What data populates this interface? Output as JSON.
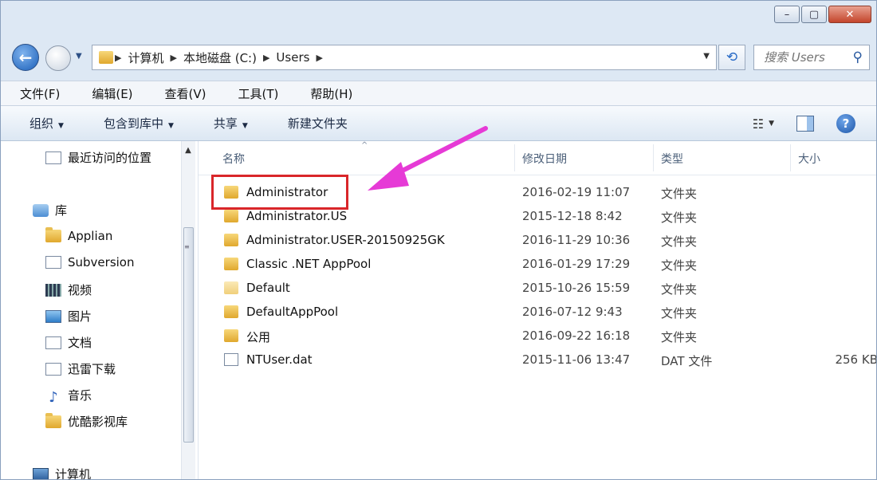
{
  "window": {
    "controls": {
      "minimize": "–",
      "maximize": "▢",
      "close": "✕"
    }
  },
  "navigation": {
    "back_glyph": "←",
    "history_drop": "▼",
    "breadcrumb": [
      "计算机",
      "本地磁盘 (C:)",
      "Users"
    ],
    "address_drop": "▼",
    "refresh_glyph": "⟲",
    "search_placeholder": "搜索 Users",
    "search_icon_glyph": "⚲"
  },
  "menubar": [
    "文件(F)",
    "编辑(E)",
    "查看(V)",
    "工具(T)",
    "帮助(H)"
  ],
  "toolbar": {
    "items": [
      "组织",
      "包含到库中",
      "共享",
      "新建文件夹"
    ],
    "dropdown_glyph": "▼",
    "view_glyph": "☷",
    "help_glyph": "?"
  },
  "sidebar": {
    "items": [
      {
        "label": "最近访问的位置",
        "icon": "recent-places-icon"
      },
      {
        "label": "库",
        "icon": "library-icon"
      },
      {
        "label": "Applian",
        "icon": "folder-icon"
      },
      {
        "label": "Subversion",
        "icon": "subversion-icon"
      },
      {
        "label": "视频",
        "icon": "video-icon"
      },
      {
        "label": "图片",
        "icon": "pictures-icon"
      },
      {
        "label": "文档",
        "icon": "documents-icon"
      },
      {
        "label": "迅雷下载",
        "icon": "download-icon"
      },
      {
        "label": "音乐",
        "icon": "music-icon"
      },
      {
        "label": "优酷影视库",
        "icon": "folder-icon"
      },
      {
        "label": "计算机",
        "icon": "computer-icon"
      }
    ],
    "scroll_up_glyph": "▲",
    "scroll_grip": "≡"
  },
  "columns": {
    "name": "名称",
    "date": "修改日期",
    "type": "类型",
    "size": "大小",
    "sort_glyph": "^"
  },
  "files": [
    {
      "name": "Administrator",
      "date": "2016-02-19 11:07",
      "type": "文件夹",
      "size": "",
      "kind": "folder"
    },
    {
      "name": "Administrator.US",
      "date": "2015-12-18 8:42",
      "type": "文件夹",
      "size": "",
      "kind": "folder"
    },
    {
      "name": "Administrator.USER-20150925GK",
      "date": "2016-11-29 10:36",
      "type": "文件夹",
      "size": "",
      "kind": "folder"
    },
    {
      "name": "Classic .NET AppPool",
      "date": "2016-01-29 17:29",
      "type": "文件夹",
      "size": "",
      "kind": "folder"
    },
    {
      "name": "Default",
      "date": "2015-10-26 15:59",
      "type": "文件夹",
      "size": "",
      "kind": "folder-light"
    },
    {
      "name": "DefaultAppPool",
      "date": "2016-07-12 9:43",
      "type": "文件夹",
      "size": "",
      "kind": "folder"
    },
    {
      "name": "公用",
      "date": "2016-09-22 16:18",
      "type": "文件夹",
      "size": "",
      "kind": "folder"
    },
    {
      "name": "NTUser.dat",
      "date": "2015-11-06 13:47",
      "type": "DAT 文件",
      "size": "256 KB",
      "kind": "file"
    }
  ],
  "colors": {
    "highlight_box": "#d9262a",
    "arrow": "#e63ad6"
  }
}
